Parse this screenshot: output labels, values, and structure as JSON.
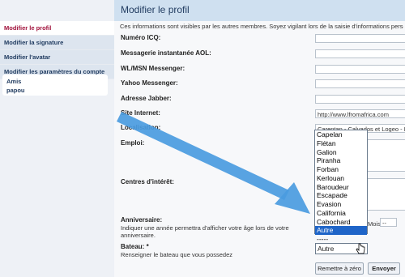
{
  "nav": {
    "items": [
      {
        "label": "Modifier le profil",
        "active": true
      },
      {
        "label": "Modifier la signature",
        "active": false
      },
      {
        "label": "Modifier l'avatar",
        "active": false
      },
      {
        "label": "Modifier les paramètres du compte",
        "active": false
      }
    ],
    "friends": [
      "Amis",
      "papou"
    ]
  },
  "header": {
    "title": "Modifier le profil"
  },
  "intro": "Ces informations sont visibles par les autres membres. Soyez vigilant lors de la saisie d'informations personnelles.",
  "form": {
    "icq": {
      "label": "Numéro ICQ:",
      "value": ""
    },
    "aol": {
      "label": "Messagerie instantanée AOL:",
      "value": ""
    },
    "msn": {
      "label": "WL/MSN Messenger:",
      "value": ""
    },
    "yahoo": {
      "label": "Yahoo Messenger:",
      "value": ""
    },
    "jabber": {
      "label": "Adresse Jabber:",
      "value": ""
    },
    "website": {
      "label": "Site Internet:",
      "value": "http://www.lfromafrica.com"
    },
    "location": {
      "label": "Localisation:",
      "value": "Carentan - Calvados et Logeo - Finistère"
    },
    "occupation": {
      "label": "Emploi:",
      "value": ""
    },
    "interests": {
      "label": "Centres d'intérêt:",
      "value": ""
    },
    "birthday": {
      "label": "Anniversaire:",
      "help": "Indiquer une année permettra d'afficher votre âge lors de votre anniversaire.",
      "year_label": "Mois:",
      "year_value": "--"
    },
    "boat": {
      "label": "Bateau: *",
      "help": "Renseigner le bateau que vous possedez",
      "selected": "Autre"
    }
  },
  "dropdown": {
    "options": [
      "Capelan",
      "Flétan",
      "Galion",
      "Piranha",
      "Forban",
      "Kerlouan",
      "Baroudeur",
      "Escapade",
      "Evasion",
      "California",
      "Cabochard",
      "Autre",
      "-----"
    ],
    "highlighted": "Autre"
  },
  "buttons": {
    "reset": "Remettre à zéro",
    "submit": "Envoyer"
  },
  "colors": {
    "arrow": "#4a9be0",
    "accent": "#a0103a",
    "highlight": "#1f65c8"
  }
}
